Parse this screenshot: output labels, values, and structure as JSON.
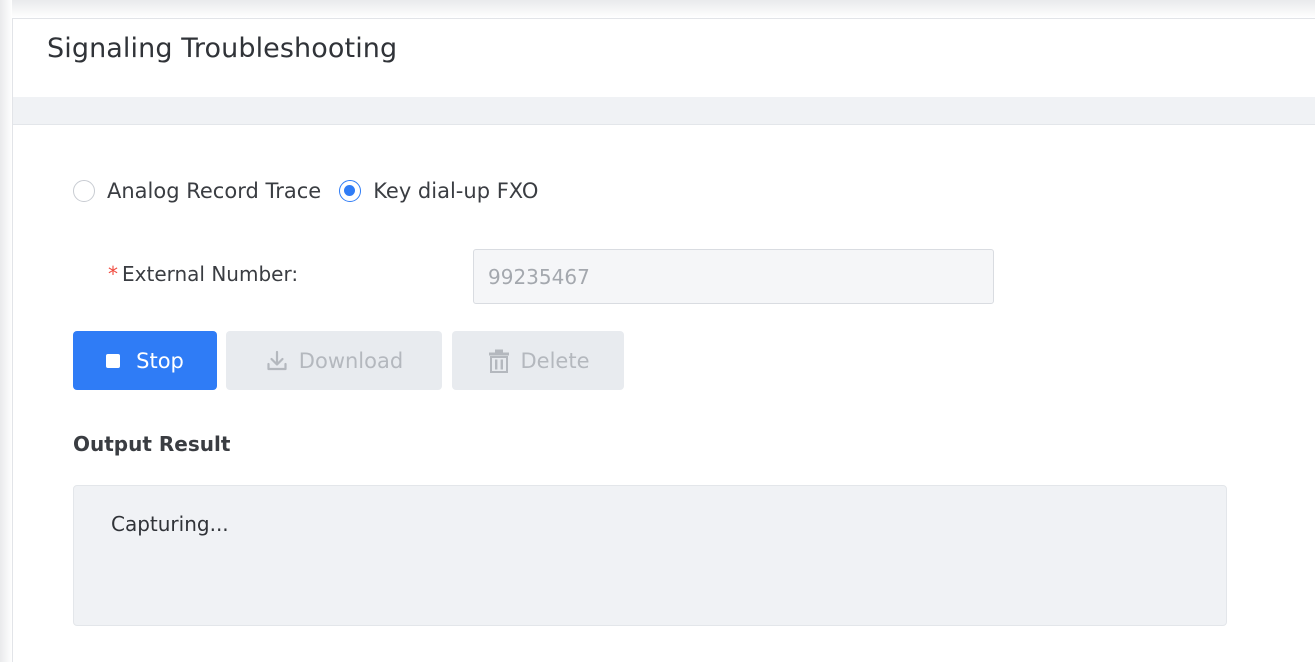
{
  "page": {
    "title": "Signaling Troubleshooting"
  },
  "mode": {
    "options": [
      {
        "label": "Analog Record Trace",
        "checked": false
      },
      {
        "label": "Key dial-up FXO",
        "checked": true
      }
    ]
  },
  "form": {
    "required_mark": "*",
    "external_number_label": "External Number:",
    "external_number_value": "99235467"
  },
  "actions": {
    "stop_label": "Stop",
    "download_label": "Download",
    "delete_label": "Delete"
  },
  "output": {
    "label": "Output Result",
    "text": "Capturing..."
  },
  "colors": {
    "accent": "#2f7cf6",
    "required": "#f04a3e",
    "disabled_button_bg": "#e8ebef"
  },
  "icons": {
    "stop": "stop-square-icon",
    "download": "download-icon",
    "delete": "trash-icon"
  }
}
